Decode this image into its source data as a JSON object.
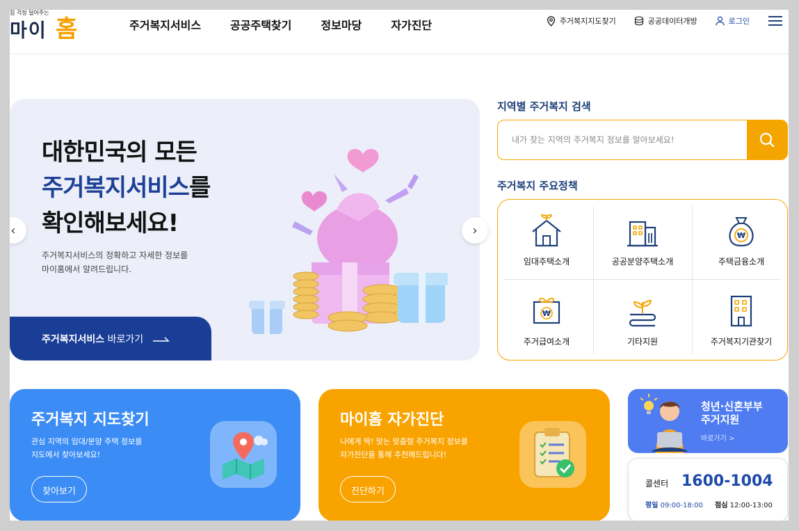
{
  "header": {
    "logo_tagline": "집 걱정 덜어주는",
    "logo_main": "마이",
    "logo_accent": "홈",
    "nav": [
      "주거복지서비스",
      "공공주택찾기",
      "정보마당",
      "자가진단"
    ],
    "util": {
      "map": "주거복지지도찾기",
      "open_data": "공공데이터개방",
      "login": "로그인"
    }
  },
  "hero": {
    "line1": "대한민국의 모든",
    "line2_blue": "주거복지서비스",
    "line2_rest": "를",
    "line3": "확인해보세요!",
    "desc1": "주거복지서비스의 정확하고 자세한 정보를",
    "desc2": "마이홈에서 알려드립니다.",
    "cta_bold": "주거복지서비스",
    "cta_rest": " 바로가기"
  },
  "search": {
    "title": "지역별 주거복지 검색",
    "placeholder": "내가 찾는 지역의 주거복지 정보를 알아보세요!"
  },
  "policy": {
    "title": "주거복지 주요정책",
    "items": [
      "임대주택소개",
      "공공분양주택소개",
      "주택금융소개",
      "주거급여소개",
      "기타지원",
      "주거복지기관찾기"
    ]
  },
  "cards": {
    "map": {
      "title": "주거복지 지도찾기",
      "desc1": "관심 지역의 임대/분양 주택 정보를",
      "desc2": "지도에서 찾아보세요!",
      "button": "찾아보기"
    },
    "diag": {
      "title": "마이홈 자가진단",
      "desc1": "나에게 딱! 맞는 맞춤형 주거복지 정보를",
      "desc2": "자가진단을 통해 추천해드립니다!",
      "button": "진단하기"
    }
  },
  "youth": {
    "title1": "청년·신혼부부",
    "title2": "주거지원",
    "link": "바로가기 >"
  },
  "callcenter": {
    "label": "콜센터",
    "number": "1600-1004",
    "weekday_label": "평일",
    "weekday_hours": " 09:00-18:00",
    "lunch_label": "점심",
    "lunch_hours": " 12:00-13:00"
  },
  "colors": {
    "navy": "#1a3e96",
    "orange": "#f5a500",
    "map_card": "#3b8cf5",
    "diag_card": "#f9a300",
    "youth_card": "#4f7cf0"
  }
}
